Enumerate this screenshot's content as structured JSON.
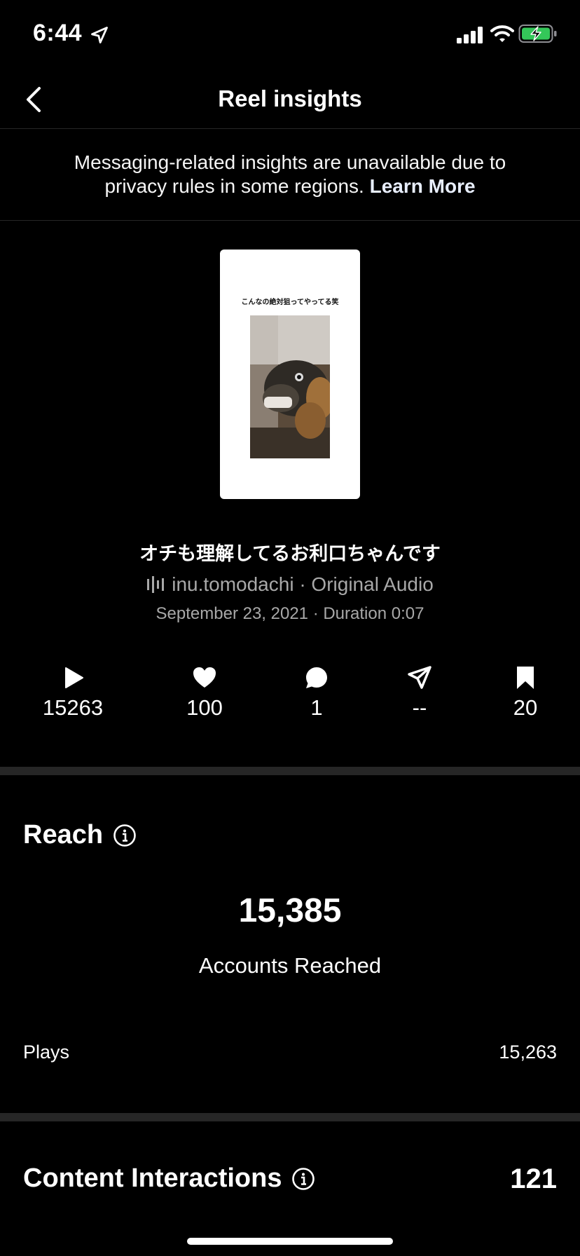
{
  "status_bar": {
    "time": "6:44"
  },
  "header": {
    "title": "Reel insights"
  },
  "notice": {
    "text": "Messaging-related insights are unavailable due to privacy rules in some regions.",
    "link": "Learn More"
  },
  "reel": {
    "thumbnail_caption": "こんなの絶対狙ってやってる笑",
    "title": "オチも理解してるお利口ちゃんです",
    "audio": "inu.tomodachi · Original Audio",
    "date_duration": "September 23, 2021 · Duration 0:07"
  },
  "stats": {
    "plays": "15263",
    "likes": "100",
    "comments": "1",
    "shares": "--",
    "saves": "20"
  },
  "reach": {
    "title": "Reach",
    "value": "15,385",
    "label": "Accounts Reached",
    "plays_label": "Plays",
    "plays_value": "15,263"
  },
  "interactions": {
    "title": "Content Interactions",
    "value": "121"
  },
  "colors": {
    "background": "#000000",
    "text": "#ffffff",
    "muted": "#a8a8a8",
    "battery": "#34c759"
  }
}
